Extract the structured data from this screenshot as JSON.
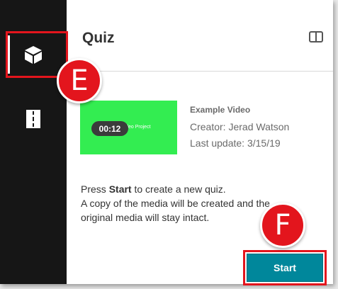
{
  "header": {
    "title": "Quiz",
    "panel_icon": "sidebar-toggle-icon"
  },
  "sidebar": {
    "items": [
      {
        "name": "cube-icon",
        "active": true
      },
      {
        "name": "book-icon",
        "active": false
      }
    ]
  },
  "media": {
    "thumbnail_text": "Video Project",
    "duration": "00:12",
    "title": "Example Video",
    "creator": "Creator: Jerad Watson",
    "last_update": "Last update: 3/15/19",
    "thumbnail_color": "#33ed51"
  },
  "instructions": {
    "line1_pre": "Press ",
    "line1_bold": "Start",
    "line1_post": " to create a new quiz.",
    "line2": "A copy of the media will be created and the",
    "line3": "original media will stay intact."
  },
  "actions": {
    "start_label": "Start",
    "accent": "#00879b"
  },
  "callouts": {
    "e_label": "E",
    "f_label": "F",
    "color": "#e3151d"
  }
}
